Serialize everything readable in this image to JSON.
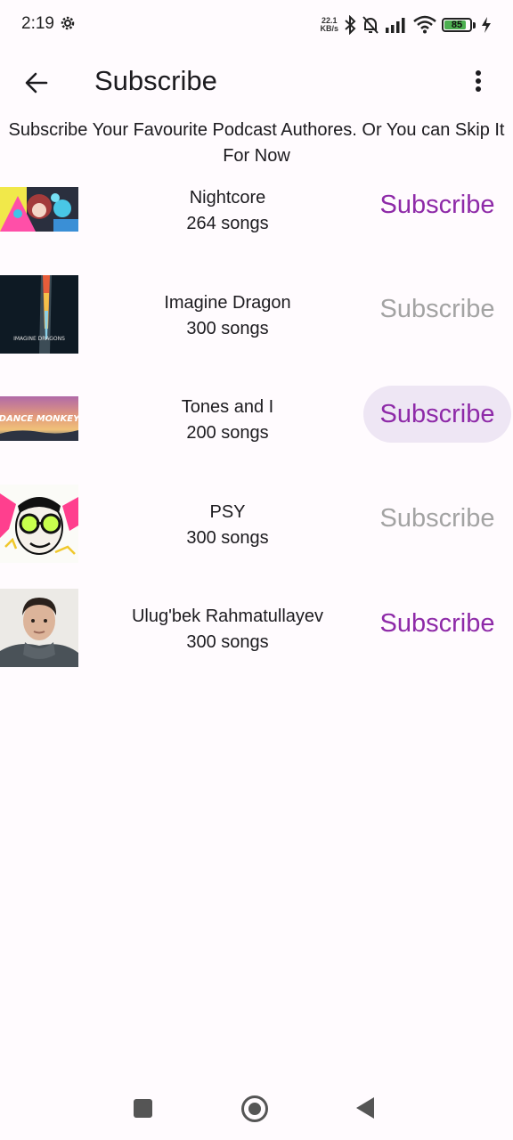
{
  "status_bar": {
    "time": "2:19",
    "net_speed_value": "22.1",
    "net_speed_unit": "KB/s",
    "battery_level": "85",
    "icons": [
      "settings-gear-icon",
      "bluetooth-icon",
      "bell-off-icon",
      "signal-icon",
      "wifi-icon",
      "battery-icon",
      "charging-bolt-icon"
    ]
  },
  "app_bar": {
    "title": "Subscribe",
    "back_icon": "arrow-back-icon",
    "menu_icon": "more-vert-icon"
  },
  "subtitle": "Subscribe Your Favourite Podcast Authores. Or You can Skip It For Now",
  "colors": {
    "accent": "#8e2aa8",
    "inactive": "#a3a3a3",
    "pressed_bg": "#eee6f4",
    "background": "#fffbfe"
  },
  "authors": [
    {
      "name": "Nightcore",
      "count": "264 songs",
      "button": "Subscribe",
      "state": "active",
      "thumb_text": ""
    },
    {
      "name": "Imagine Dragon",
      "count": "300 songs",
      "button": "Subscribe",
      "state": "inactive",
      "thumb_text": "IMAGINE DRAGONS"
    },
    {
      "name": "Tones and I",
      "count": "200 songs",
      "button": "Subscribe",
      "state": "active-pressed",
      "thumb_text": "DANCE MONKEY"
    },
    {
      "name": "PSY",
      "count": "300 songs",
      "button": "Subscribe",
      "state": "inactive",
      "thumb_text": ""
    },
    {
      "name": "Ulug'bek Rahmatullayev",
      "count": "300 songs",
      "button": "Subscribe",
      "state": "active",
      "thumb_text": ""
    }
  ],
  "nav_bar": {
    "icons": [
      "recents-square-icon",
      "home-circle-icon",
      "back-triangle-icon"
    ]
  }
}
